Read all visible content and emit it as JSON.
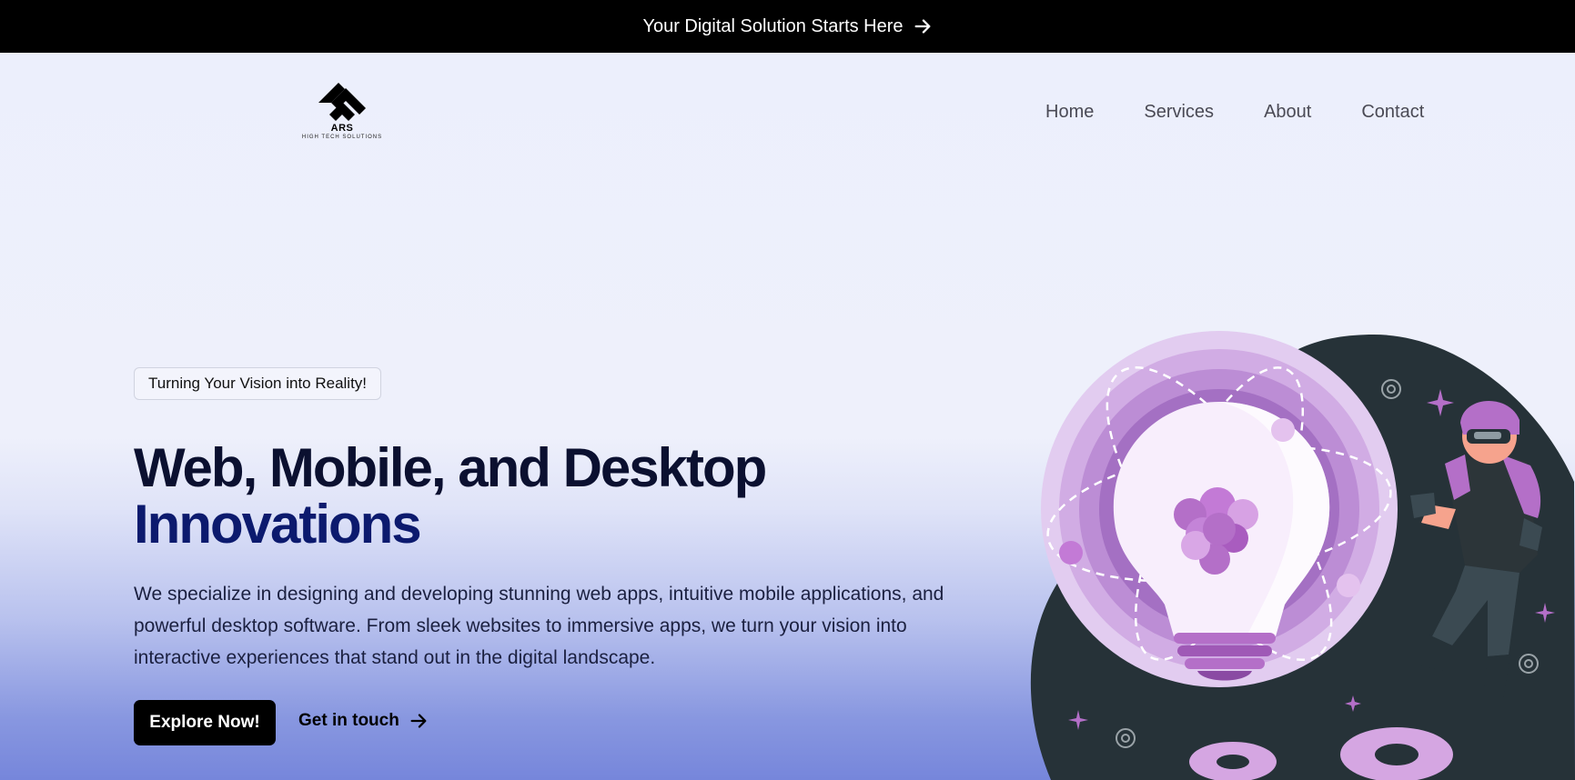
{
  "announcement": {
    "text": "Your Digital Solution Starts Here",
    "icon": "arrow-right-icon"
  },
  "logo": {
    "brand": "ARS",
    "tagline": "HIGH TECH SOLUTIONS"
  },
  "nav": {
    "items": [
      {
        "label": "Home"
      },
      {
        "label": "Services"
      },
      {
        "label": "About"
      },
      {
        "label": "Contact"
      }
    ]
  },
  "hero": {
    "badge": "Turning Your Vision into Reality!",
    "headline_line1": "Web, Mobile, and Desktop",
    "headline_line2": "Innovations",
    "description": "We specialize in designing and developing stunning web apps, intuitive mobile applications, and powerful desktop software. From sleek websites to immersive apps, we turn your vision into interactive experiences that stand out in the digital landscape.",
    "primary_cta": "Explore Now!",
    "secondary_cta": "Get in touch",
    "secondary_cta_icon": "arrow-right-icon",
    "illustration": "vr-user-lightbulb-illustration"
  },
  "colors": {
    "announcement_bg": "#000000",
    "headline_dark": "#0b1030",
    "headline_accent": "#0c1a6e",
    "primary_button_bg": "#000000",
    "illustration_purple": "#b46fc8",
    "illustration_dark": "#263238"
  }
}
